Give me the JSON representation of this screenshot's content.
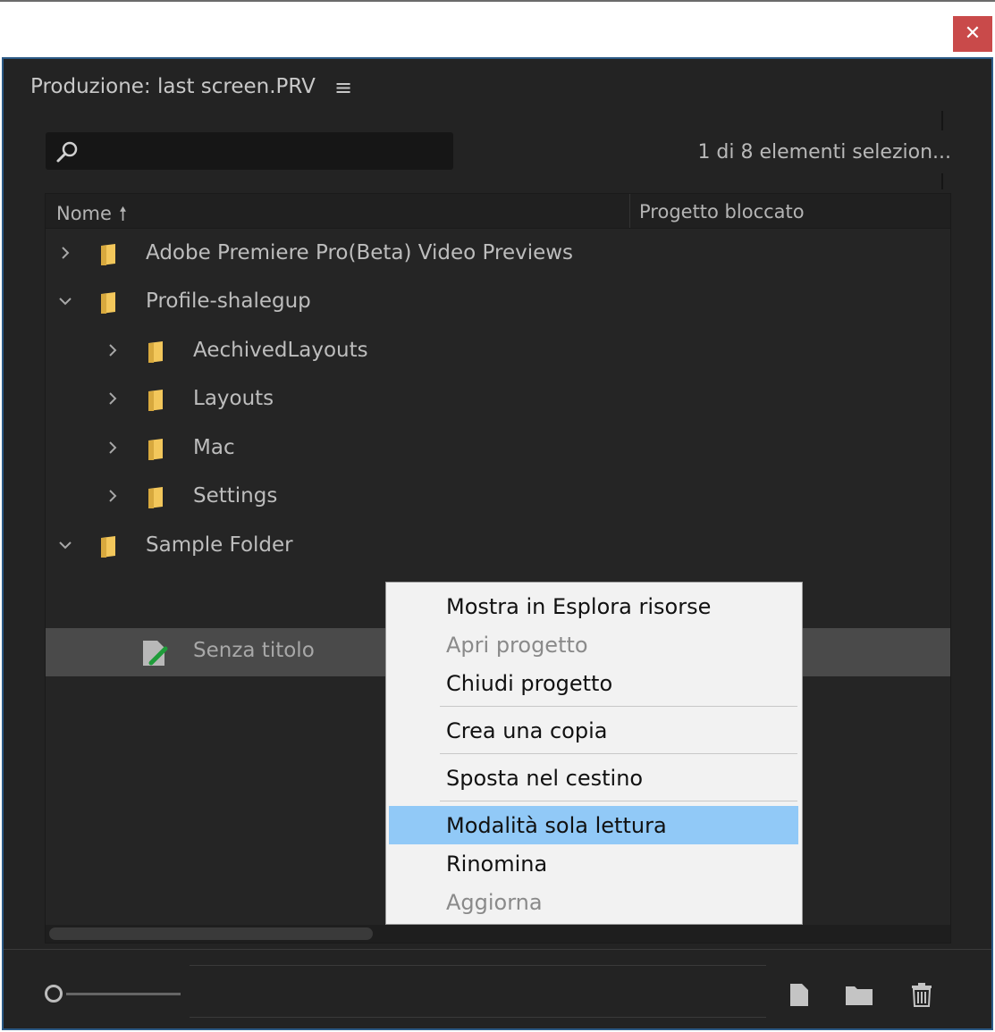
{
  "window": {
    "close_glyph": "✕"
  },
  "panel": {
    "title": "Produzione: last screen.PRV",
    "menu_glyph": "≡",
    "selection_status": "1 di 8 elementi selezion..."
  },
  "search": {
    "placeholder": ""
  },
  "columns": {
    "name": "Nome",
    "sort_arrow": "🠕",
    "locked": "Progetto bloccato"
  },
  "rows": [
    {
      "label": "Adobe Premiere Pro(Beta) Video Previews",
      "type": "folder",
      "expanded": false,
      "level": 0
    },
    {
      "label": "Profile-shalegup",
      "type": "folder",
      "expanded": true,
      "level": 0
    },
    {
      "label": "AechivedLayouts",
      "type": "folder",
      "expanded": false,
      "level": 1
    },
    {
      "label": "Layouts",
      "type": "folder",
      "expanded": false,
      "level": 1
    },
    {
      "label": "Mac",
      "type": "folder",
      "expanded": false,
      "level": 1
    },
    {
      "label": "Settings",
      "type": "folder",
      "expanded": false,
      "level": 1
    },
    {
      "label": "Sample Folder",
      "type": "folder",
      "expanded": true,
      "level": 0
    },
    {
      "label": "Senza titolo",
      "type": "project",
      "selected": true,
      "level": 1
    }
  ],
  "context_menu": {
    "items": [
      {
        "label": "Mostra in Esplora risorse",
        "enabled": true
      },
      {
        "label": "Apri progetto",
        "enabled": false
      },
      {
        "label": "Chiudi progetto",
        "enabled": true
      },
      {
        "label": "Crea una copia",
        "enabled": true
      },
      {
        "label": "Sposta nel cestino",
        "enabled": true
      },
      {
        "label": "Modalità sola lettura",
        "enabled": true,
        "highlighted": true
      },
      {
        "label": "Rinomina",
        "enabled": true
      },
      {
        "label": "Aggiorna",
        "enabled": false
      }
    ]
  },
  "colors": {
    "panel_bg": "#232323",
    "panel_border": "#2c5a86",
    "close_red": "#c94a4a",
    "folder_yellow": "#f3c75b",
    "highlight_blue": "#91c9f7",
    "project_green": "#1f9c3a"
  },
  "icons": {
    "search": "search-icon",
    "new_item": "new-item-icon",
    "new_folder": "new-folder-icon",
    "trash": "trash-icon"
  }
}
